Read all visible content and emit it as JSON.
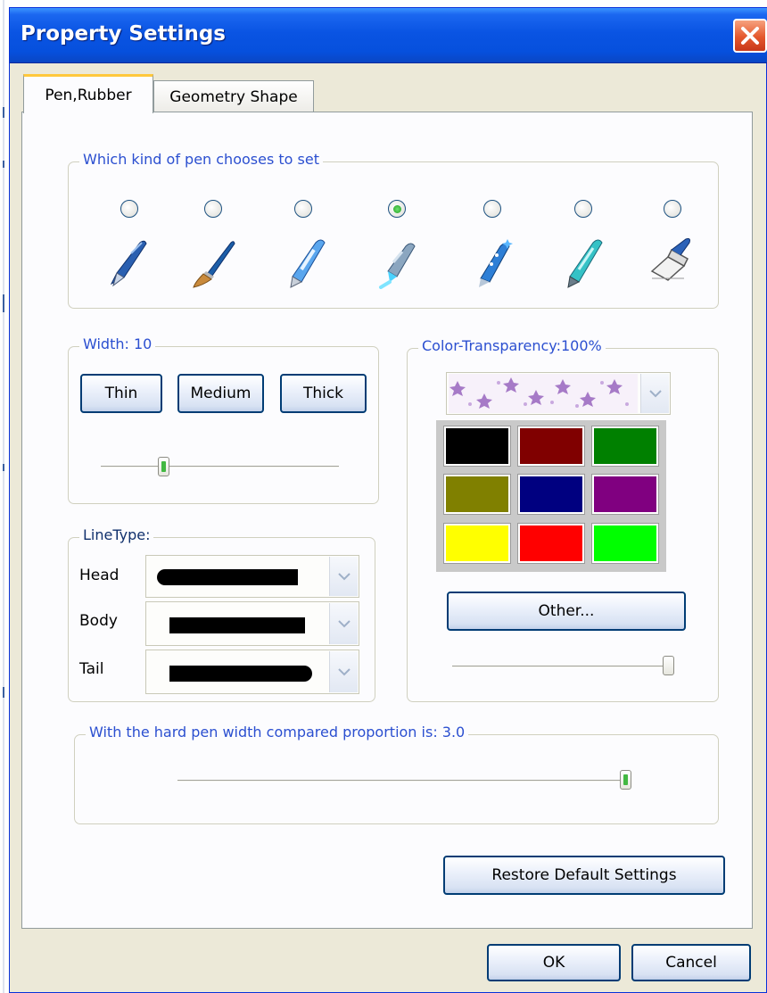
{
  "window": {
    "title": "Property Settings"
  },
  "tabs": [
    {
      "label": "Pen,Rubber",
      "active": true
    },
    {
      "label": "Geometry Shape",
      "active": false
    }
  ],
  "pen_kind": {
    "legend": "Which kind of pen chooses to set",
    "selected_index": 3,
    "pens": [
      "ballpoint-pen-icon",
      "paint-brush-icon",
      "highlighter-pen-icon",
      "light-pen-icon",
      "sparkle-pen-icon",
      "marker-pen-icon",
      "eraser-icon"
    ]
  },
  "width": {
    "legend": "Width: 10",
    "buttons": [
      "Thin",
      "Medium",
      "Thick"
    ],
    "slider_value": 10
  },
  "line_type": {
    "legend": "LineType:",
    "rows": [
      {
        "label": "Head"
      },
      {
        "label": "Body"
      },
      {
        "label": "Tail"
      }
    ]
  },
  "color": {
    "legend": "Color-Transparency:100%",
    "transparency_percent": 100,
    "swatches": [
      "#000000",
      "#800000",
      "#008000",
      "#808000",
      "#000080",
      "#800080",
      "#ffff00",
      "#ff0000",
      "#00ff00"
    ],
    "other_button": "Other..."
  },
  "proportion": {
    "legend": "With the hard pen width compared proportion is: 3.0",
    "value": 3.0
  },
  "restore_button": "Restore Default Settings",
  "ok_button": "OK",
  "cancel_button": "Cancel"
}
